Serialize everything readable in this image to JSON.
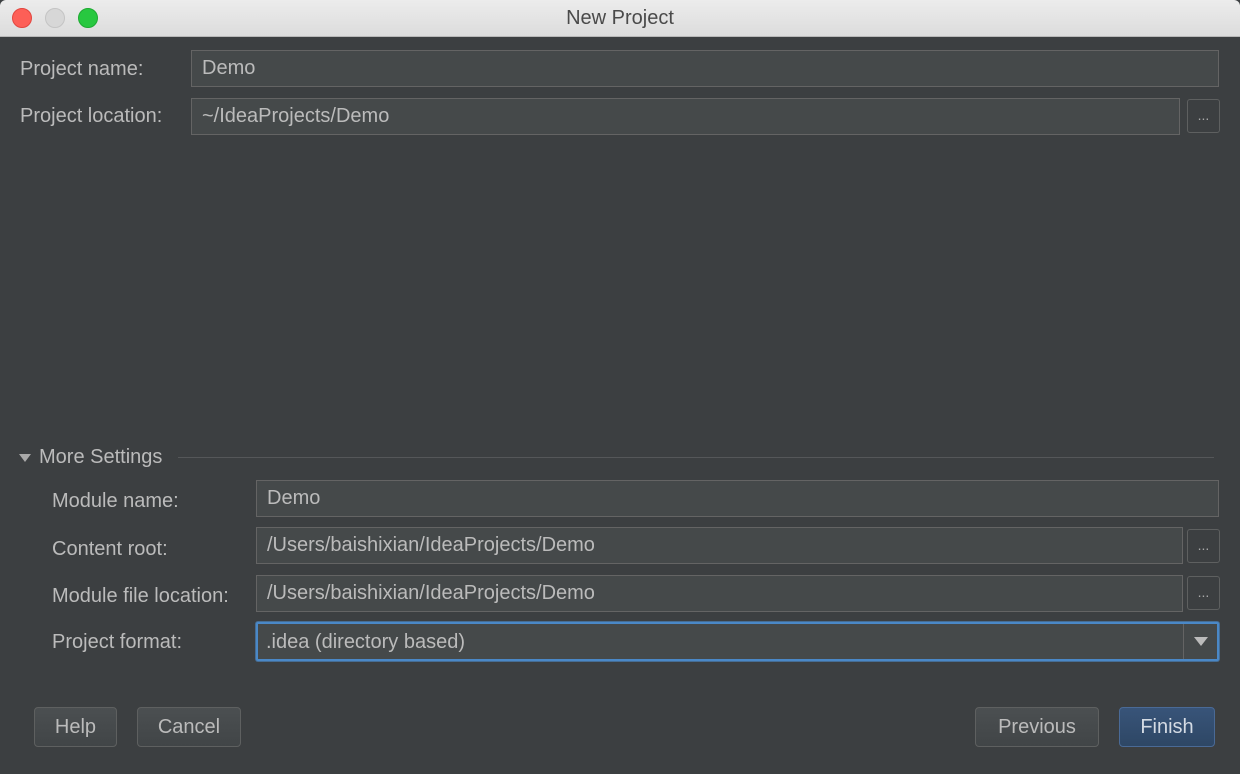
{
  "window": {
    "title": "New Project"
  },
  "project": {
    "name_label": "Project name:",
    "name_value": "Demo",
    "location_label": "Project location:",
    "location_value": "~/IdeaProjects/Demo",
    "browse_label": "..."
  },
  "more_settings": {
    "toggle_label": "More Settings",
    "expanded": true,
    "module_name_label": "Module name:",
    "module_name_value": "Demo",
    "content_root_label": "Content root:",
    "content_root_value": "/Users/baishixian/IdeaProjects/Demo",
    "module_file_label": "Module file location:",
    "module_file_value": "/Users/baishixian/IdeaProjects/Demo",
    "project_format_label": "Project format:",
    "project_format_value": ".idea (directory based)",
    "browse_label": "..."
  },
  "buttons": {
    "help": "Help",
    "cancel": "Cancel",
    "previous": "Previous",
    "finish": "Finish"
  },
  "colors": {
    "background": "#3c3f41",
    "field_bg": "#45494a",
    "focus_border": "#4a88c7",
    "primary_button": "#365880"
  }
}
